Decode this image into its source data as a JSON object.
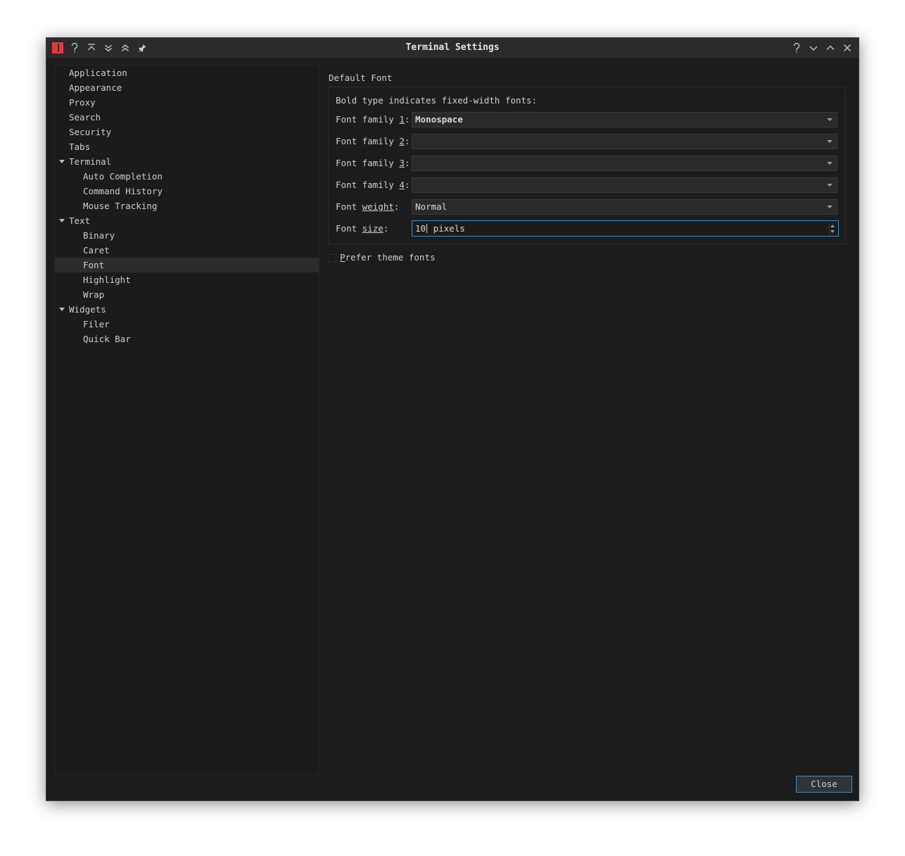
{
  "window": {
    "title": "Terminal Settings",
    "app_logo": "app-logo-red",
    "left_buttons": [
      "help-icon",
      "keep-below-icon",
      "shade-down-icon",
      "shade-up-icon",
      "pin-icon"
    ],
    "right_buttons": [
      "help-icon",
      "minimize-icon",
      "maximize-icon",
      "close-icon"
    ]
  },
  "sidebar": {
    "items": [
      {
        "label": "Application"
      },
      {
        "label": "Appearance"
      },
      {
        "label": "Proxy"
      },
      {
        "label": "Search"
      },
      {
        "label": "Security"
      },
      {
        "label": "Tabs"
      },
      {
        "label": "Terminal",
        "expanded": true
      },
      {
        "label": "Auto Completion"
      },
      {
        "label": "Command History"
      },
      {
        "label": "Mouse Tracking"
      },
      {
        "label": "Text",
        "expanded": true
      },
      {
        "label": "Binary"
      },
      {
        "label": "Caret"
      },
      {
        "label": "Font",
        "selected": true
      },
      {
        "label": "Highlight"
      },
      {
        "label": "Wrap"
      },
      {
        "label": "Widgets",
        "expanded": true
      },
      {
        "label": "Filer"
      },
      {
        "label": "Quick Bar"
      }
    ]
  },
  "default_font": {
    "group_title": "Default Font",
    "note": "Bold type indicates fixed-width fonts:",
    "family_1": {
      "label_pre": "Font family ",
      "label_key": "1",
      "label_post": ":",
      "value": "Monospace"
    },
    "family_2": {
      "label_pre": "Font family ",
      "label_key": "2",
      "label_post": ":",
      "value": ""
    },
    "family_3": {
      "label_pre": "Font family ",
      "label_key": "3",
      "label_post": ":",
      "value": ""
    },
    "family_4": {
      "label_pre": "Font family ",
      "label_key": "4",
      "label_post": ":",
      "value": ""
    },
    "weight": {
      "label_pre": "Font ",
      "label_key": "weight",
      "label_post": ":",
      "value": "Normal"
    },
    "size": {
      "label_pre": "Font ",
      "label_key": "size",
      "label_post": ":",
      "value": "10",
      "suffix": " pixels"
    }
  },
  "prefer_theme_fonts": {
    "label_key": "P",
    "label_rest": "refer theme fonts",
    "checked": false
  },
  "buttons": {
    "close": "Close"
  },
  "colors": {
    "accent": "#3a90d0",
    "logo": "#e53935",
    "background": "#1c1c1c"
  }
}
